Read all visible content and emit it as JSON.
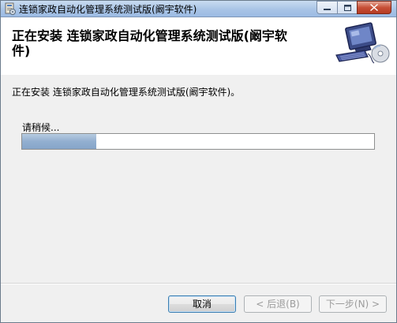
{
  "window": {
    "title": "连锁家政自动化管理系统测试版(阚宇软件)",
    "icons": {
      "app": "installer-icon",
      "minimize": "minimize-icon",
      "maximize": "maximize-icon",
      "close": "close-icon"
    }
  },
  "header": {
    "title": "正在安装 连锁家政自动化管理系统测试版(阚宇软件)",
    "art_icon": "computer-install-icon"
  },
  "main": {
    "status_text": "正在安装 连锁家政自动化管理系统测试版(阚宇软件)。",
    "wait_text": "请稍候...",
    "progress": 0.21
  },
  "buttons": {
    "cancel": "取消",
    "back": "< 后退(B)",
    "next": "下一步(N) >"
  },
  "colors": {
    "progress_fill": "#92afd0",
    "close_button": "#c75037"
  }
}
